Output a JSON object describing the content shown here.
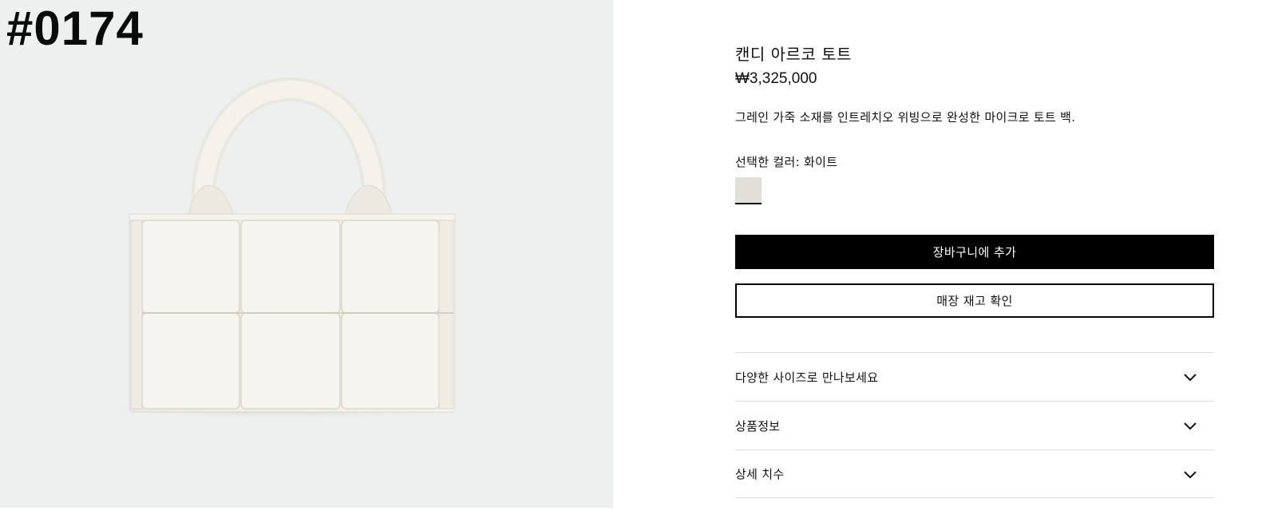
{
  "image_id": "#0174",
  "product": {
    "title": "캔디 아르코 토트",
    "price": "₩3,325,000",
    "description": "그레인 가죽 소재를 인트레치오 위빙으로 완성한 마이크로 토트 백.",
    "selected_color_label": "선택한 컬러: 화이트",
    "swatch_color": "#e1dfd8"
  },
  "actions": {
    "add_to_cart": "장바구니에 추가",
    "check_store_stock": "매장 재고 확인"
  },
  "accordion": [
    {
      "label": "다양한 사이즈로 만나보세요",
      "icon": "chevron-down-icon"
    },
    {
      "label": "상품정보",
      "icon": "chevron-down-icon"
    },
    {
      "label": "상세 치수",
      "icon": "chevron-down-icon"
    }
  ],
  "colors": {
    "image_background": "#edf0ef",
    "bag": "#f3f1ea",
    "primary_button": "#000000"
  }
}
